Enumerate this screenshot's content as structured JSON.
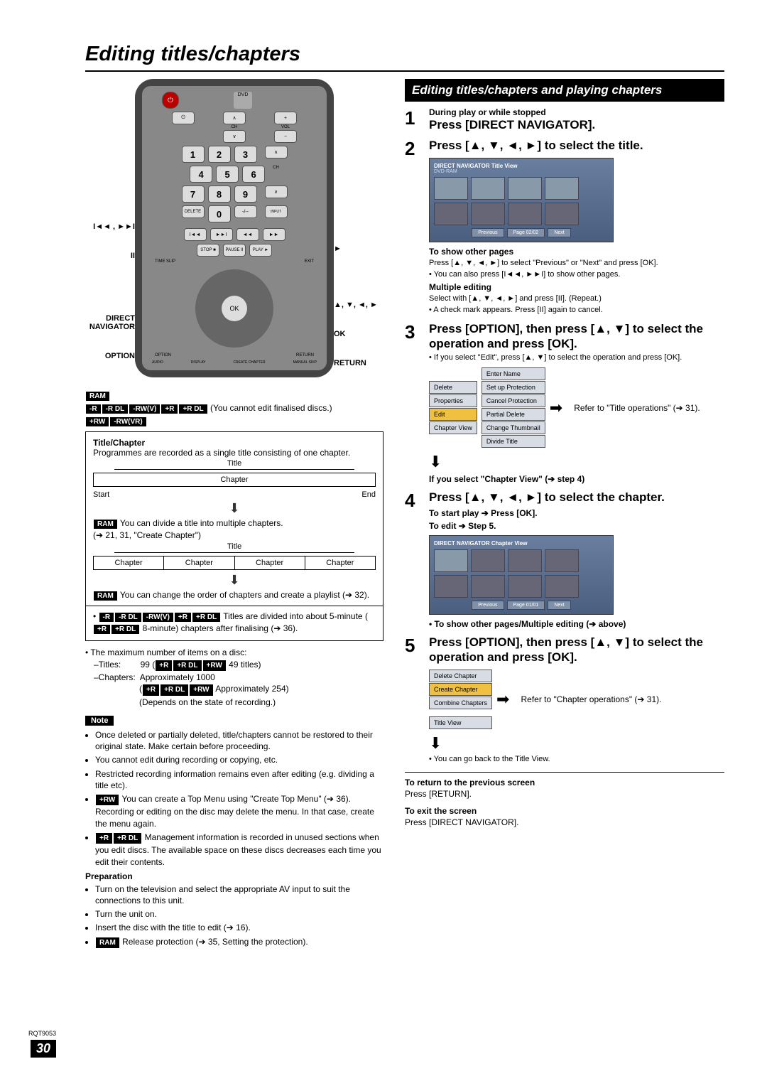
{
  "page_title": "Editing titles/chapters",
  "disc_tags_line1": [
    "RAM"
  ],
  "disc_tags_line2": [
    "-R",
    "-R DL",
    "-RW(V)",
    "+R",
    "+R DL"
  ],
  "disc_tags_line2_after": " (You cannot edit finalised discs.)",
  "disc_tags_line3": [
    "+RW",
    "-RW(VR)"
  ],
  "titlechapter": {
    "heading": "Title/Chapter",
    "intro": "Programmes are recorded as a single title consisting of one chapter.",
    "title_label": "Title",
    "chapter_label": "Chapter",
    "start": "Start",
    "end": "End",
    "ram_split": " You can divide a title into multiple chapters.",
    "ram_split_ref": "(➔ 21, 31, \"Create Chapter\")",
    "ram_order": " You can change the order of chapters and create a playlist (➔ 32).",
    "divided_text": " Titles are divided into about 5-minute (",
    "divided_tags": [
      "+R",
      "+R DL"
    ],
    "divided_text2": " 8-minute) chapters after finalising (➔ 36)."
  },
  "maxitems": {
    "lead": "The maximum number of items on a disc:",
    "titles_label": "–Titles:",
    "titles_val": "99 (",
    "titles_tags": [
      "+R",
      "+R DL",
      "+RW"
    ],
    "titles_after": " 49 titles)",
    "chapters_label": "–Chapters:",
    "chapters_val": "Approximately 1000",
    "chapters_tags": [
      "+R",
      "+R DL",
      "+RW"
    ],
    "chapters_after": " Approximately 254)",
    "chapters_note": "(Depends on the state of recording.)"
  },
  "note": {
    "label": "Note",
    "b1": "Once deleted or partially deleted, title/chapters cannot be restored to their original state. Make certain before proceeding.",
    "b2": "You cannot edit during recording or copying, etc.",
    "b3": "Restricted recording information remains even after editing (e.g. dividing a title etc).",
    "b4_tag": "+RW",
    "b4": " You can create a Top Menu using \"Create Top Menu\" (➔ 36). Recording or editing on the disc may delete the menu. In that case, create the menu again.",
    "b5_tags": [
      "+R",
      "+R DL"
    ],
    "b5": " Management information is recorded in unused sections when you edit discs. The available space on these discs decreases each time you edit their contents."
  },
  "prep": {
    "heading": "Preparation",
    "b1": "Turn on the television and select the appropriate AV input to suit the connections to this unit.",
    "b2": "Turn the unit on.",
    "b3": "Insert the disc with the title to edit (➔ 16).",
    "b4_tag": "RAM",
    "b4": " Release protection (➔ 35, Setting the protection)."
  },
  "rightbar_title": "Editing titles/chapters and playing chapters",
  "steps": {
    "s1_pre": "During play or while stopped",
    "s1_main": "Press [DIRECT NAVIGATOR].",
    "s2_main": "Press [▲, ▼, ◄, ►] to select the title.",
    "screen1_title": "DIRECT NAVIGATOR   Title View",
    "screen1_sub": "DVD-RAM",
    "screen1_prev": "Previous",
    "screen1_page": "Page   02/02",
    "screen1_next": "Next",
    "s2_sub1": "To show other pages",
    "s2_note1": "Press [▲, ▼, ◄, ►] to select \"Previous\" or \"Next\" and press [OK].",
    "s2_note2": "• You can also press [I◄◄, ►►I] to show other pages.",
    "s2_sub2": "Multiple editing",
    "s2_note3": "Select with [▲, ▼, ◄, ►] and press [II]. (Repeat.)",
    "s2_note4": "• A check mark appears. Press [II] again to cancel.",
    "s3_main": "Press [OPTION], then press [▲, ▼] to select the operation and press [OK].",
    "s3_note": "• If you select \"Edit\", press [▲, ▼] to select the operation and press [OK].",
    "menu1_left": [
      "Delete",
      "Properties",
      "Edit",
      "Chapter View"
    ],
    "menu1_right": [
      "Enter Name",
      "Set up Protection",
      "Cancel Protection",
      "Partial Delete",
      "Change Thumbnail",
      "Divide Title"
    ],
    "s3_ref": "Refer to \"Title operations\" (➔ 31).",
    "s3_after": "If you select \"Chapter View\" (➔ step 4)",
    "s4_main": "Press [▲, ▼, ◄, ►] to select the chapter.",
    "s4_sub1": "To start play ➔ Press [OK].",
    "s4_sub2": "To edit ➔ Step 5.",
    "screen2_title": "DIRECT NAVIGATOR   Chapter View",
    "screen2_prev": "Previous",
    "screen2_page": "Page   01/01",
    "screen2_next": "Next",
    "s4_note": "• To show other pages/Multiple editing (➔ above)",
    "s5_main": "Press [OPTION], then press [▲, ▼] to select the operation and press [OK].",
    "menu2": [
      "Delete Chapter",
      "Create Chapter",
      "Combine Chapters",
      "Title View"
    ],
    "s5_ref": "Refer to \"Chapter operations\" (➔ 31).",
    "s5_note": "• You can go back to the Title View.",
    "return_h": "To return to the previous screen",
    "return_t": "Press [RETURN].",
    "exit_h": "To exit the screen",
    "exit_t": "Press [DIRECT NAVIGATOR]."
  },
  "callouts": {
    "l1": "I◄◄ , ►►I",
    "l2": "II",
    "l3": "DIRECT NAVIGATOR",
    "l4": "OPTION",
    "r1": "►",
    "r2": "▲, ▼, ◄, ►",
    "r3": "OK",
    "r4": "RETURN"
  },
  "footer": {
    "rqt": "RQT9053",
    "page": "30"
  }
}
